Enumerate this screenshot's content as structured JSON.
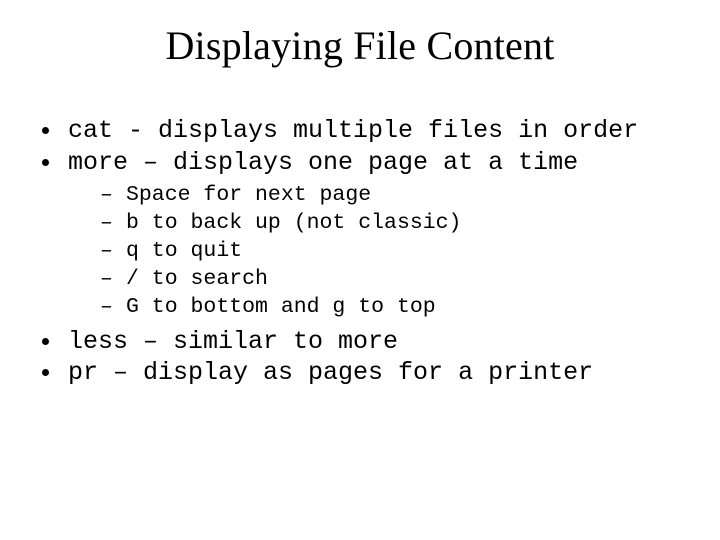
{
  "title": "Displaying File Content",
  "bullets": {
    "cat": "cat - displays multiple files in order",
    "more": "more – displays one page at a time",
    "less": "less – similar to more",
    "pr": "pr – display as pages for a printer"
  },
  "more_sub": {
    "space": "Space for next page",
    "back": "b to back up (not classic)",
    "quit": "q to quit",
    "search": "/ to search",
    "goto": "G to bottom and g to top"
  }
}
